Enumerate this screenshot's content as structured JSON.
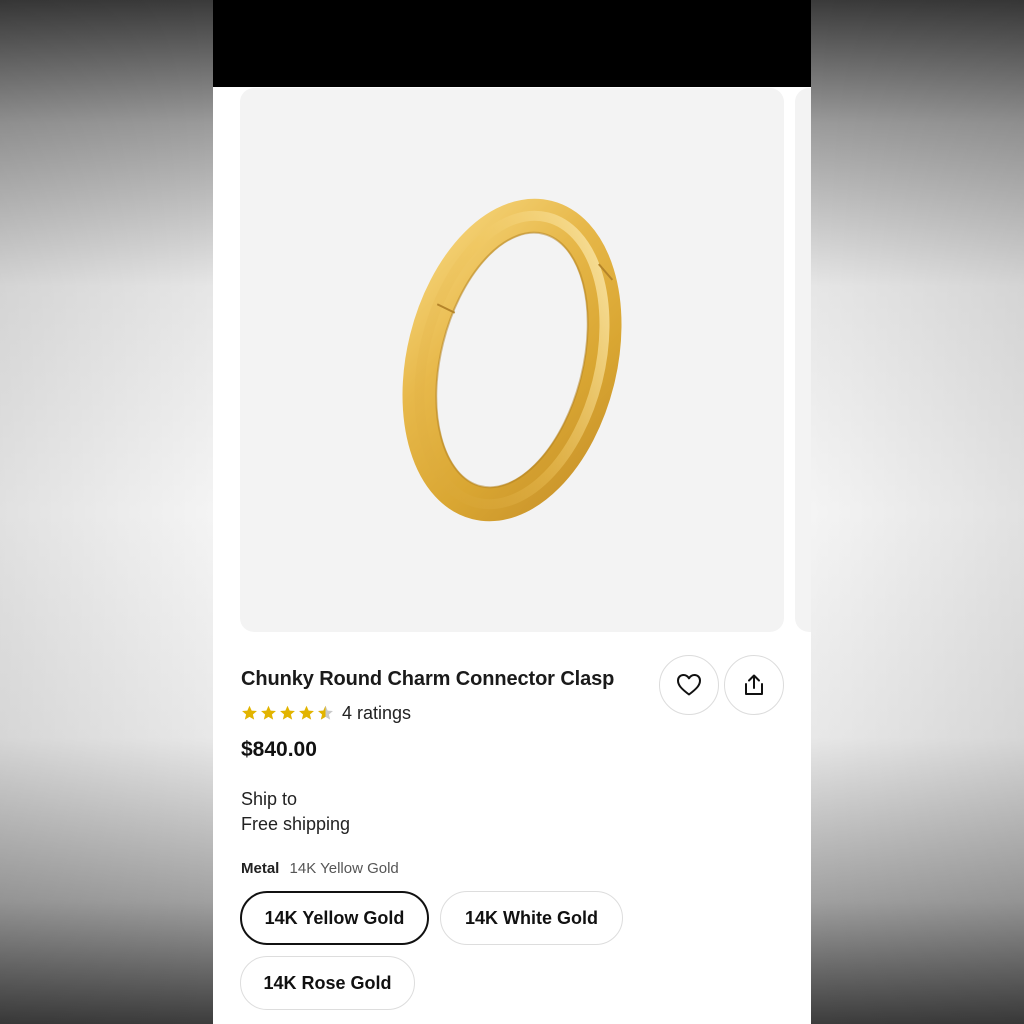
{
  "product": {
    "title": "Chunky Round Charm Connector Clasp",
    "rating": 4.5,
    "ratings_text": "4 ratings",
    "price": "$840.00",
    "image_icon": "gold-ring-image"
  },
  "shipping": {
    "label": "Ship to",
    "value": "Free shipping"
  },
  "metal": {
    "label": "Metal",
    "selected": "14K Yellow Gold",
    "options": [
      "14K Yellow Gold",
      "14K White Gold",
      "14K Rose Gold"
    ]
  },
  "actions": {
    "favorite_icon": "heart-icon",
    "share_icon": "share-icon"
  },
  "colors": {
    "star": "#e2b400",
    "star_empty": "#c9c9c9",
    "selected_border": "#111111",
    "gold": "#e3b545"
  }
}
